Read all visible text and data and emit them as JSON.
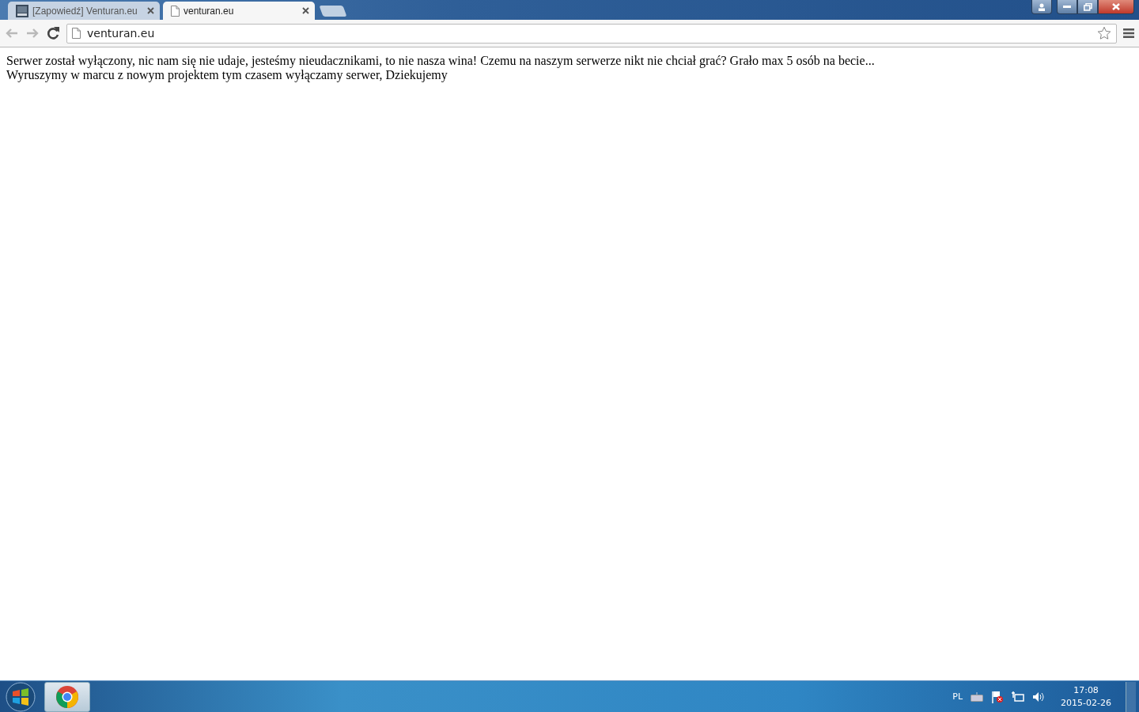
{
  "tabs": [
    {
      "title": "[Zapowiedź] Venturan.eu",
      "selected": false,
      "kind": "favicon"
    },
    {
      "title": "venturan.eu",
      "selected": true,
      "kind": "page"
    }
  ],
  "address_bar": {
    "value": "venturan.eu"
  },
  "page": {
    "lines": [
      "Serwer został wyłączony, nic nam się nie udaje, jesteśmy nieudacznikami, to nie nasza wina! Czemu na naszym serwerze nikt nie chciał grać? Grało max 5 osób na becie...",
      "Wyruszymy w marcu z nowym projektem tym czasem wyłączamy serwer, Dziekujemy"
    ]
  },
  "taskbar": {
    "apps": [
      {
        "kind": "chrome",
        "active": true
      }
    ],
    "language": "PL",
    "time": "17:08",
    "date": "2015-02-26"
  }
}
